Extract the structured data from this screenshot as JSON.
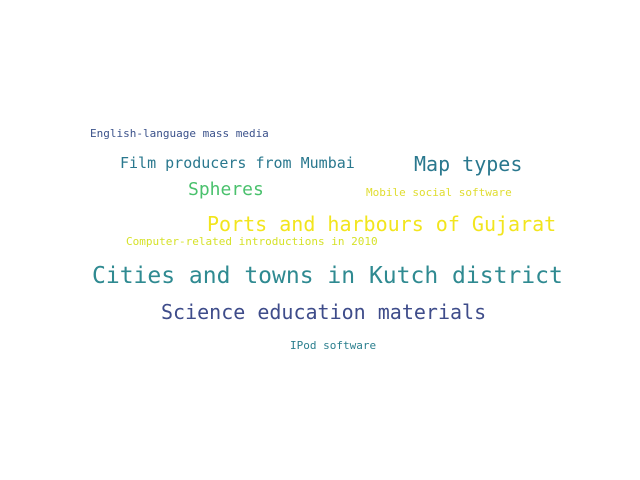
{
  "words": [
    {
      "text": "English-language mass media",
      "color": "#3b528b"
    },
    {
      "text": "Film producers from Mumbai",
      "color": "#2a788e"
    },
    {
      "text": "Map types",
      "color": "#2a788e"
    },
    {
      "text": "Spheres",
      "color": "#4ac16d"
    },
    {
      "text": "Mobile social software",
      "color": "#e0dd30"
    },
    {
      "text": "Ports and harbours of Gujarat",
      "color": "#f2e51d"
    },
    {
      "text": "Computer-related introductions in 2010",
      "color": "#d6e22a"
    },
    {
      "text": "Cities and towns in Kutch district",
      "color": "#2f8a91"
    },
    {
      "text": "Science education materials",
      "color": "#3e4c8a"
    },
    {
      "text": "IPod software",
      "color": "#2b7f8e"
    }
  ]
}
